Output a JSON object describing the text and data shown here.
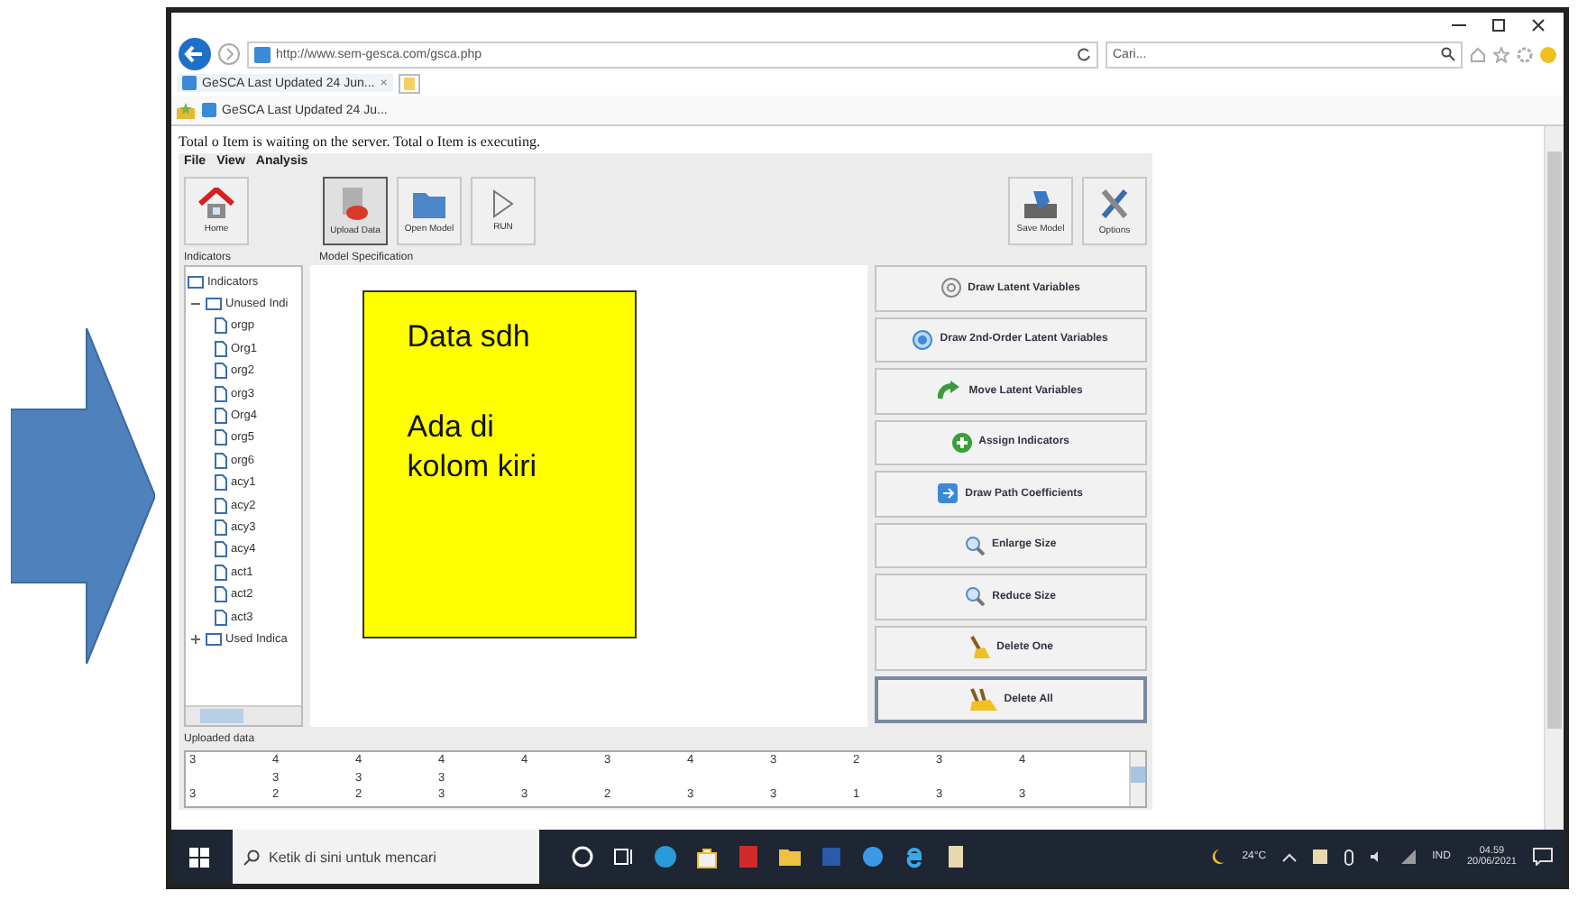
{
  "browser": {
    "address": "http://www.sem-gesca.com/gsca.php",
    "search_placeholder": "Cari...",
    "tab": {
      "label": "GeSCA Last Updated 24 Jun...",
      "close": "×"
    },
    "favorite": "GeSCA Last Updated 24 Ju..."
  },
  "app": {
    "status": "Total o Item is waiting on the server. Total o Item is executing.",
    "menu": [
      "File",
      "View",
      "Analysis"
    ],
    "toolbar": [
      {
        "label": "Home",
        "kind": "home",
        "selected": false
      },
      {
        "label": "Upload Data",
        "kind": "upload",
        "selected": true
      },
      {
        "label": "Open Model",
        "kind": "open",
        "selected": false
      },
      {
        "label": "RUN",
        "kind": "run",
        "selected": false
      },
      {
        "label": "Save Model",
        "kind": "save",
        "selected": false
      },
      {
        "label": "Options",
        "kind": "options",
        "selected": false
      }
    ],
    "indicators_label": "Indicators",
    "model_label": "Model Specification",
    "tree": [
      {
        "label": "Indicators",
        "children": [
          {
            "label": "Unused Indi",
            "expanded": true,
            "children": [
              {
                "label": "orgp"
              },
              {
                "label": "Org1"
              },
              {
                "label": "org2"
              },
              {
                "label": "org3"
              },
              {
                "label": "Org4"
              },
              {
                "label": "org5"
              },
              {
                "label": "org6"
              },
              {
                "label": "acy1"
              },
              {
                "label": "acy2"
              },
              {
                "label": "acy3"
              },
              {
                "label": "acy4"
              },
              {
                "label": "act1"
              },
              {
                "label": "act2"
              },
              {
                "label": "act3"
              }
            ]
          },
          {
            "label": "Used Indica",
            "expanded": false
          }
        ]
      }
    ],
    "note": [
      "Data sdh",
      "Ada di",
      "kolom kiri"
    ],
    "actions": [
      {
        "label": "Draw Latent Variables",
        "kind": "circle",
        "focused": false
      },
      {
        "label": "Draw 2nd-Order Latent Variables",
        "kind": "dot",
        "focused": false
      },
      {
        "label": "Move Latent Variables",
        "kind": "move",
        "focused": false
      },
      {
        "label": "Assign Indicators",
        "kind": "plus",
        "focused": false
      },
      {
        "label": "Draw Path Coefficients",
        "kind": "path",
        "focused": false
      },
      {
        "label": "Enlarge Size",
        "kind": "zoom",
        "focused": false
      },
      {
        "label": "Reduce Size",
        "kind": "zoom",
        "focused": false
      },
      {
        "label": "Delete One",
        "kind": "broom",
        "focused": false
      },
      {
        "label": "Delete All",
        "kind": "brooms",
        "focused": true
      }
    ],
    "data_label": "Uploaded data",
    "data_rows": [
      [
        "3",
        "4",
        "4",
        "4",
        "4",
        "3",
        "4",
        "3",
        "2",
        "3",
        "4"
      ],
      [
        null,
        "3",
        "3",
        "3",
        null,
        null,
        null,
        null,
        null,
        null,
        null
      ],
      [
        "3",
        "2",
        "2",
        "3",
        "3",
        "2",
        "3",
        "3",
        "1",
        "3",
        "3"
      ]
    ]
  },
  "taskbar": {
    "search_placeholder": "Ketik di sini untuk mencari",
    "temperature": "24°C",
    "language": "IND",
    "time": "04.59",
    "date": "20/06/2021"
  }
}
